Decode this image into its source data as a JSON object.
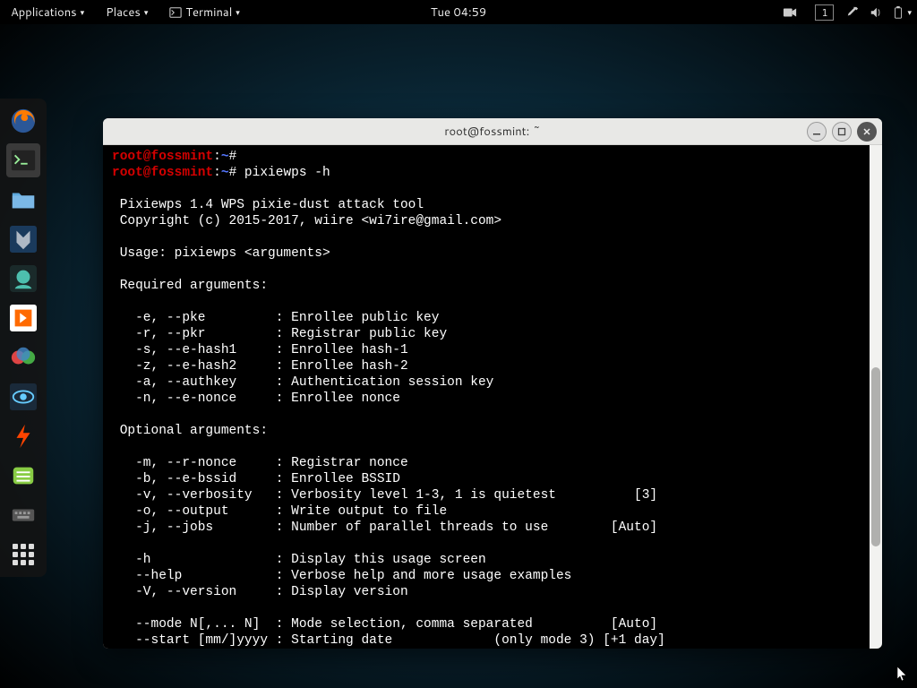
{
  "topbar": {
    "applications": "Applications",
    "places": "Places",
    "terminal": "Terminal",
    "clock": "Tue 04:59",
    "workspace": "1"
  },
  "dock": {
    "items": [
      "firefox",
      "terminal",
      "files",
      "metasploit",
      "spectra",
      "burp",
      "recorder",
      "zenmap",
      "leafpad",
      "tweaks",
      "apps"
    ]
  },
  "window": {
    "title": "root@fossmint: ~"
  },
  "terminal": {
    "prompt_userhost": "root@fossmint",
    "prompt_sep": ":",
    "prompt_path": "~",
    "prompt_hash": "#",
    "cmd1": "",
    "cmd2": " pixiewps -h",
    "lines": {
      "l1": " Pixiewps 1.4 WPS pixie-dust attack tool",
      "l2": " Copyright (c) 2015-2017, wiire <wi7ire@gmail.com>",
      "l3": " Usage: pixiewps <arguments>",
      "l4": " Required arguments:",
      "l5": "   -e, --pke         : Enrollee public key",
      "l6": "   -r, --pkr         : Registrar public key",
      "l7": "   -s, --e-hash1     : Enrollee hash-1",
      "l8": "   -z, --e-hash2     : Enrollee hash-2",
      "l9": "   -a, --authkey     : Authentication session key",
      "l10": "   -n, --e-nonce     : Enrollee nonce",
      "l11": " Optional arguments:",
      "l12": "   -m, --r-nonce     : Registrar nonce",
      "l13": "   -b, --e-bssid     : Enrollee BSSID",
      "l14": "   -v, --verbosity   : Verbosity level 1-3, 1 is quietest          [3]",
      "l15": "   -o, --output      : Write output to file",
      "l16": "   -j, --jobs        : Number of parallel threads to use        [Auto]",
      "l17": "   -h                : Display this usage screen",
      "l18": "   --help            : Verbose help and more usage examples",
      "l19": "   -V, --version     : Display version",
      "l20": "   --mode N[,... N]  : Mode selection, comma separated          [Auto]",
      "l21": "   --start [mm/]yyyy : Starting date             (only mode 3) [+1 day]"
    }
  }
}
